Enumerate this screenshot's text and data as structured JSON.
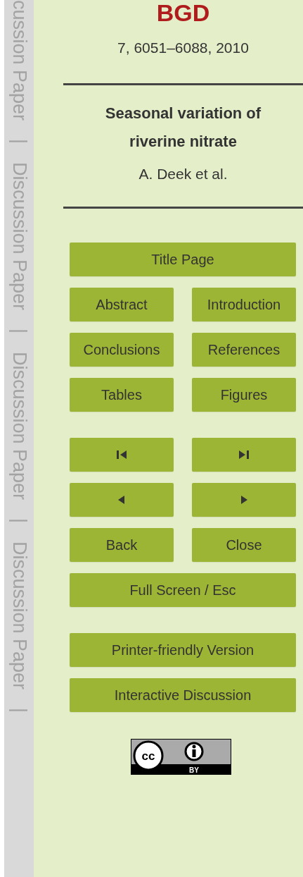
{
  "margin_labels": [
    "cussion Paper",
    "|",
    "Discussion Paper",
    "|",
    "Discussion Paper",
    "|",
    "Discussion Paper",
    "|"
  ],
  "journal": "BGD",
  "citation": "7, 6051–6088, 2010",
  "title": "Seasonal variation of riverine nitrate",
  "authors": "A. Deek et al.",
  "button_sections": [
    {
      "rows": [
        {
          "buttons": [
            {
              "kind": "text",
              "label": "Title Page"
            }
          ]
        },
        {
          "buttons": [
            {
              "kind": "text",
              "label": "Abstract"
            },
            {
              "kind": "text",
              "label": "Introduction"
            }
          ]
        },
        {
          "buttons": [
            {
              "kind": "text",
              "label": "Conclusions"
            },
            {
              "kind": "text",
              "label": "References"
            }
          ]
        },
        {
          "buttons": [
            {
              "kind": "text",
              "label": "Tables"
            },
            {
              "kind": "text",
              "label": "Figures"
            }
          ]
        }
      ]
    },
    {
      "rows": [
        {
          "buttons": [
            {
              "kind": "first"
            },
            {
              "kind": "last"
            }
          ]
        },
        {
          "buttons": [
            {
              "kind": "previous"
            },
            {
              "kind": "next"
            }
          ]
        },
        {
          "buttons": [
            {
              "kind": "text",
              "label": "Back"
            },
            {
              "kind": "text",
              "label": "Close"
            }
          ]
        },
        {
          "buttons": [
            {
              "kind": "text",
              "label": "Full Screen / Esc"
            }
          ]
        }
      ]
    },
    {
      "rows": [
        {
          "buttons": [
            {
              "kind": "text",
              "label": "Printer-friendly Version"
            }
          ]
        },
        {
          "buttons": [
            {
              "kind": "text",
              "label": "Interactive Discussion"
            }
          ]
        }
      ]
    }
  ],
  "license_badge": {
    "top": "cc",
    "bottom": "BY"
  }
}
